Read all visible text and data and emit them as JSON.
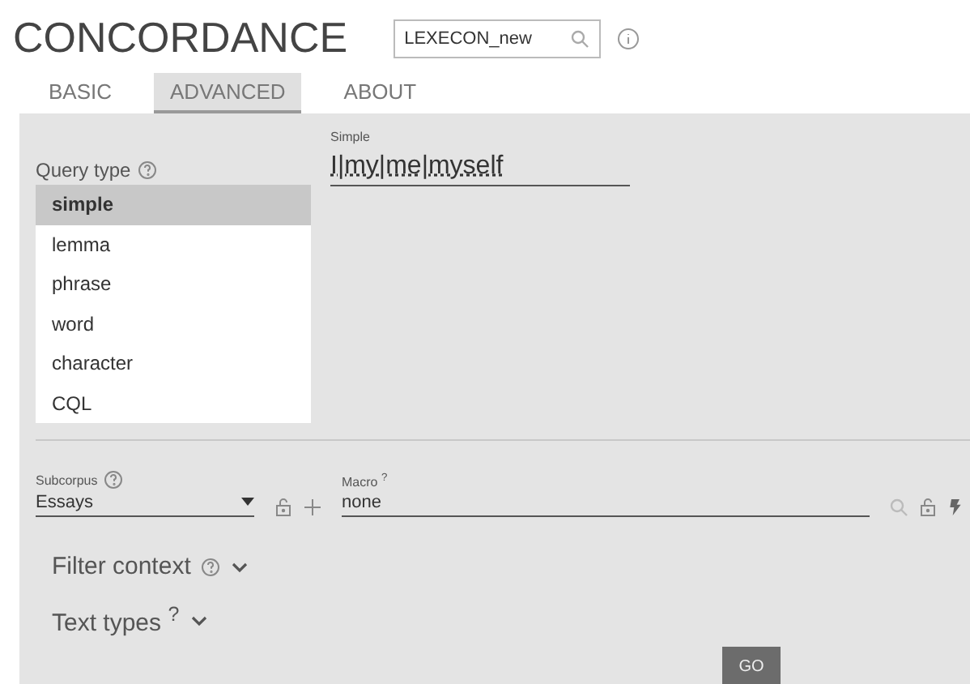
{
  "header": {
    "title": "CONCORDANCE",
    "corpus": {
      "value": "LEXECON_new"
    }
  },
  "tabs": [
    {
      "label": "BASIC",
      "selected": false
    },
    {
      "label": "ADVANCED",
      "selected": true
    },
    {
      "label": "ABOUT",
      "selected": false
    }
  ],
  "query_type": {
    "label": "Query type",
    "options": [
      {
        "label": "simple",
        "selected": true
      },
      {
        "label": "lemma",
        "selected": false
      },
      {
        "label": "phrase",
        "selected": false
      },
      {
        "label": "word",
        "selected": false
      },
      {
        "label": "character",
        "selected": false
      },
      {
        "label": "CQL",
        "selected": false
      }
    ]
  },
  "query": {
    "label": "Simple",
    "value": "I|my|me|myself"
  },
  "subcorpus": {
    "label": "Subcorpus",
    "value": "Essays"
  },
  "macro": {
    "label": "Macro $^{?}$",
    "value": "none"
  },
  "sections": [
    {
      "label": "Filter context",
      "has_help": true,
      "expanded": false
    },
    {
      "label": "Text types $^{?}$",
      "has_help": false,
      "expanded": false
    }
  ],
  "go_button": "GO"
}
